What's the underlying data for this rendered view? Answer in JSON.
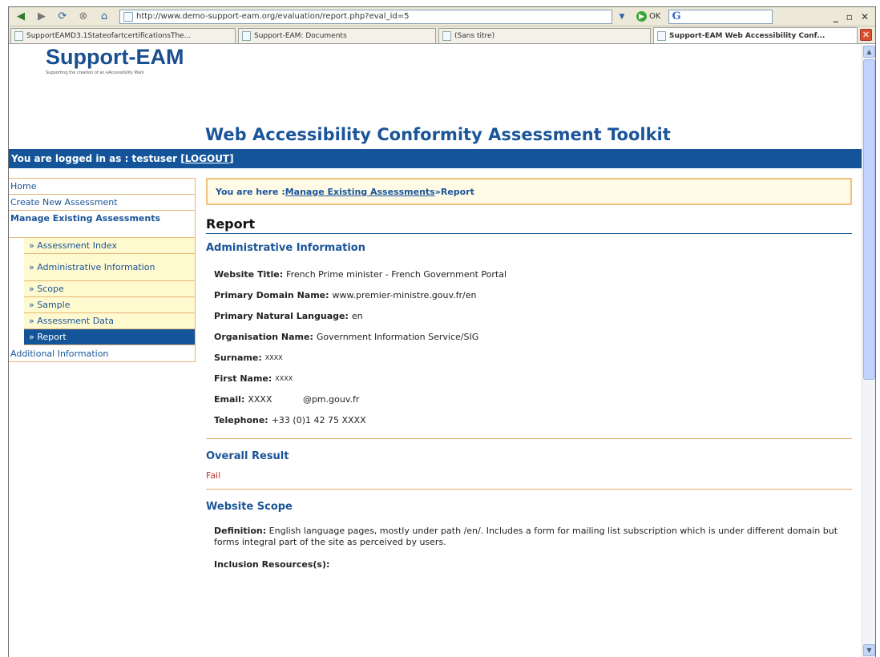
{
  "browser": {
    "url": "http://www.demo-support-eam.org/evaluation/report.php?eval_id=5",
    "go_label": "OK",
    "tabs": [
      {
        "label": "SupportEAMD3.1StateofartcertificationsThe..."
      },
      {
        "label": "Support-EAM: Documents"
      },
      {
        "label": "(Sans titre)"
      },
      {
        "label": "Support-EAM Web Accessibility Conf..."
      }
    ]
  },
  "header": {
    "brand": "Support-EAM",
    "tagline": "Supporting the creation of an eAccessibility Mark",
    "title": "Web Accessibility Conformity Assessment Toolkit"
  },
  "login": {
    "prefix": "You are logged in as : testuser [ ",
    "logout": "LOGOUT",
    "suffix": " ]"
  },
  "sidebar": {
    "home": "Home",
    "create": "Create New Assessment",
    "manage": "Manage Existing Assessments",
    "sub": [
      "» Assessment Index",
      "» Administrative Information",
      "» Scope",
      "» Sample",
      "» Assessment Data",
      "» Report"
    ],
    "additional": "Additional Information"
  },
  "breadcrumb": {
    "prefix": "You are here : ",
    "link": "Manage Existing Assessments",
    "sep": " » ",
    "current": "Report"
  },
  "report": {
    "heading": "Report",
    "admin_heading": "Administrative Information",
    "fields": [
      {
        "label": "Website Title:",
        "value": "French Prime minister - French Government Portal"
      },
      {
        "label": "Primary Domain Name:",
        "value": "www.premier-ministre.gouv.fr/en"
      },
      {
        "label": "Primary Natural Language:",
        "value": "en"
      },
      {
        "label": "Organisation Name:",
        "value": "Government Information Service/SIG"
      },
      {
        "label": "Surname:",
        "value": "XXXX"
      },
      {
        "label": "First Name:",
        "value": "XXXX"
      },
      {
        "label": "Email:",
        "value": "XXXX           @pm.gouv.fr"
      },
      {
        "label": "Telephone:",
        "value": "+33 (0)1 42 75 XXXX"
      }
    ],
    "overall_heading": "Overall Result",
    "overall_value": "Fail",
    "scope_heading": "Website Scope",
    "definition_label": "Definition:",
    "definition_value": "English language pages, mostly under path /en/. Includes a form for mailing list subscription which is under different domain but forms integral part of the site as perceived by users.",
    "inclusion_label": "Inclusion Resources(s):"
  },
  "colors": {
    "accent": "#14559a",
    "link": "#1a5599",
    "border": "#e5b779",
    "fail": "#c0392b"
  }
}
